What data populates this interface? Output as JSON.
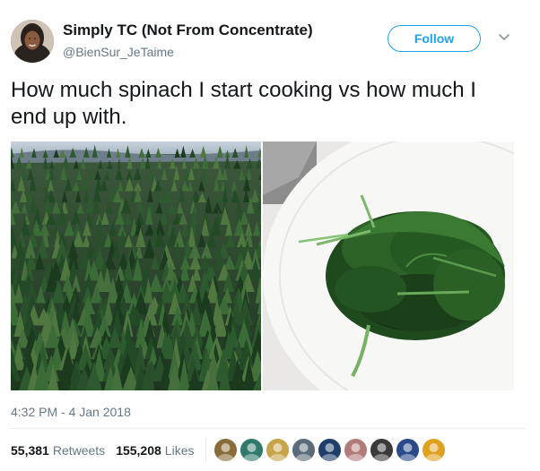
{
  "author": {
    "name": "Simply TC (Not From Concentrate)",
    "handle": "@BienSur_JeTaime"
  },
  "follow_label": "Follow",
  "tweet": {
    "text": "How much spinach I start cooking vs how much I end up with."
  },
  "photos": [
    {
      "subject": "forest"
    },
    {
      "subject": "cooked spinach on plate"
    }
  ],
  "timestamp": "4:32 PM - 4 Jan 2018",
  "stats": {
    "retweets_count": "55,381",
    "retweets_label": "Retweets",
    "likes_count": "155,208",
    "likes_label": "Likes"
  },
  "likers": [
    {
      "color": "#8a6b3a"
    },
    {
      "color": "#2f7a6a"
    },
    {
      "color": "#c7a34a"
    },
    {
      "color": "#5a6b7a"
    },
    {
      "color": "#1f3f6a"
    },
    {
      "color": "#b37a7a"
    },
    {
      "color": "#3a3a3a"
    },
    {
      "color": "#2a4a8a"
    },
    {
      "color": "#e0a020"
    }
  ],
  "colors": {
    "accent": "#1da1f2",
    "secondary_text": "#657786",
    "primary_text": "#14171a"
  }
}
